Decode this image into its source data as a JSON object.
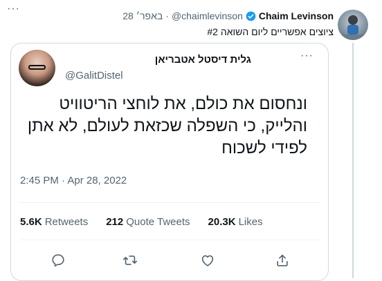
{
  "outer_tweet": {
    "author_name": "Chaim Levinson",
    "handle": "@chaimlevinson",
    "separator": "·",
    "date": "28 באפר׳",
    "text": "ציוצים אפשריים ליום השואה #2",
    "more_label": "···"
  },
  "quoted_tweet": {
    "author_name": "גלית דיסטל אטבריאן",
    "handle": "@GalitDistel",
    "more_label": "···",
    "text_lines": [
      "ונחסום את כולם, את לוחצי הריטוויט",
      "והלייק, כי השפלה שכזאת לעולם, לא אתן",
      "לפידי לשכוח"
    ],
    "timestamp": "2:45 PM · Apr 28, 2022",
    "stats": {
      "retweets_count": "5.6K",
      "retweets_label": "Retweets",
      "quotes_count": "212",
      "quotes_label": "Quote Tweets",
      "likes_count": "20.3K",
      "likes_label": "Likes"
    }
  },
  "icons": {
    "verified": "verified-badge-icon",
    "reply": "reply-icon",
    "retweet": "retweet-icon",
    "like": "heart-icon",
    "share": "share-icon"
  },
  "colors": {
    "accent": "#1d9bf0",
    "text_primary": "#0f1419",
    "text_secondary": "#536471",
    "border": "#cfd9de"
  }
}
